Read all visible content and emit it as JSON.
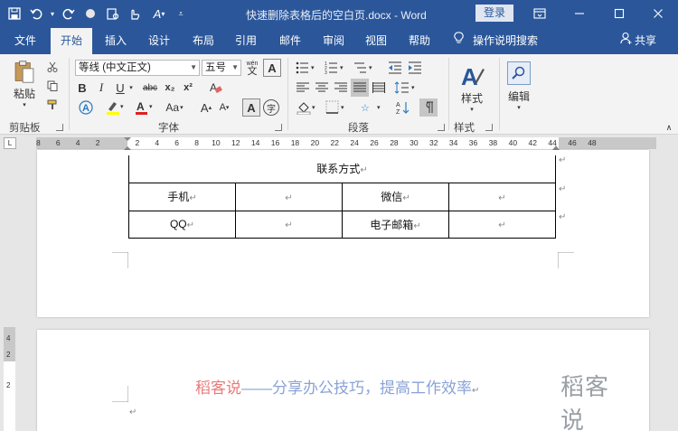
{
  "app": {
    "doc_title": "快速删除表格后的空白页.docx - Word",
    "login": "登录"
  },
  "tabs": [
    "文件",
    "开始",
    "插入",
    "设计",
    "布局",
    "引用",
    "邮件",
    "审阅",
    "视图",
    "帮助"
  ],
  "active_tab": "开始",
  "tell_me": "操作说明搜索",
  "share": "共享",
  "ribbon": {
    "clipboard": {
      "paste": "粘贴",
      "label": "剪贴板"
    },
    "font": {
      "font_name": "等线 (中文正文)",
      "font_size": "五号",
      "label": "字体",
      "bold": "B",
      "italic": "I",
      "underline": "U",
      "strike": "abc",
      "subscript": "x₂",
      "superscript": "x²",
      "grow": "A",
      "shrink": "A",
      "case": "Aa",
      "phonetic": "wén",
      "clear": "A",
      "enclose": "字"
    },
    "paragraph": {
      "label": "段落"
    },
    "styles": {
      "button": "样式",
      "label": "样式"
    },
    "editing": {
      "button": "编辑"
    }
  },
  "ruler": {
    "corner": "L",
    "h_numbers": [
      "8",
      "6",
      "4",
      "2",
      "",
      "2",
      "4",
      "6",
      "8",
      "10",
      "12",
      "14",
      "16",
      "18",
      "20",
      "22",
      "24",
      "26",
      "28",
      "30",
      "32",
      "34",
      "36",
      "38",
      "40",
      "42",
      "44",
      "46",
      "48"
    ],
    "v_numbers": [
      "4",
      "2",
      "2"
    ]
  },
  "table": {
    "header": "联系方式",
    "rows": [
      [
        "手机",
        "",
        "微信",
        ""
      ],
      [
        "QQ",
        "",
        "电子邮箱",
        ""
      ]
    ]
  },
  "page2": {
    "footer_part1": "稻客说",
    "footer_part2": "——分享办公技巧，提高工作效率",
    "logo_text": "稻客说"
  },
  "colors": {
    "brand": "#2b579a",
    "footer_red": "#e87a7a",
    "footer_blue": "#8aa2d6"
  },
  "icons": [
    "save-icon",
    "undo-icon",
    "redo-icon",
    "touch-mode-icon",
    "format-painter-icon",
    "ribbon-display-icon",
    "minimize-icon",
    "maximize-icon",
    "close-icon",
    "lightbulb-icon",
    "user-icon",
    "search-icon"
  ]
}
